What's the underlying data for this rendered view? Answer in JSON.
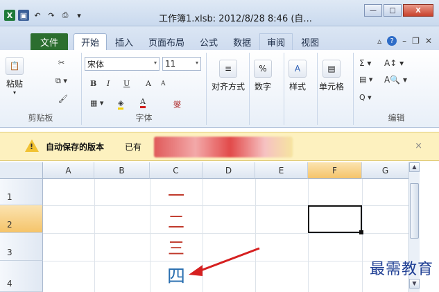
{
  "window": {
    "title": "工作簿1.xlsb: 2012/8/28 8:46 (自...",
    "minimize": "—",
    "maximize": "□",
    "close": "X"
  },
  "tabs": {
    "file": "文件",
    "items": [
      "开始",
      "插入",
      "页面布局",
      "公式",
      "数据",
      "审阅",
      "视图"
    ]
  },
  "ribbon": {
    "clipboard": {
      "paste": "粘贴",
      "label": "剪贴板"
    },
    "font": {
      "name": "宋体",
      "size": "11",
      "bold": "B",
      "italic": "I",
      "underline": "U",
      "grow": "A",
      "shrink": "A",
      "font_color": "A",
      "phonetic": "燮",
      "label": "字体"
    },
    "alignment": {
      "label": "对齐方式"
    },
    "number": {
      "label": "数字",
      "icon": "%"
    },
    "styles": {
      "label": "样式",
      "icon": "A"
    },
    "cells": {
      "label": "单元格"
    },
    "editing": {
      "sum": "Σ",
      "sort": "A",
      "find": "A",
      "clear": "Q",
      "label": "编辑"
    }
  },
  "notification": {
    "title": "自动保存的版本",
    "message": "已有",
    "close": "×"
  },
  "grid": {
    "columns": [
      "A",
      "B",
      "C",
      "D",
      "E",
      "F",
      "G"
    ],
    "rows": [
      "1",
      "2",
      "3",
      "4"
    ],
    "active_column": "F",
    "active_row": "2",
    "cells": {
      "C1": "一",
      "C2": "二",
      "C3": "三",
      "C4": "四"
    }
  },
  "colors": {
    "red_text": "#c0392b",
    "blue_text": "#2a6fb0",
    "excel_green": "#1f7a3a",
    "notify_bg": "#fdf1bf"
  },
  "watermark": "最需教育"
}
